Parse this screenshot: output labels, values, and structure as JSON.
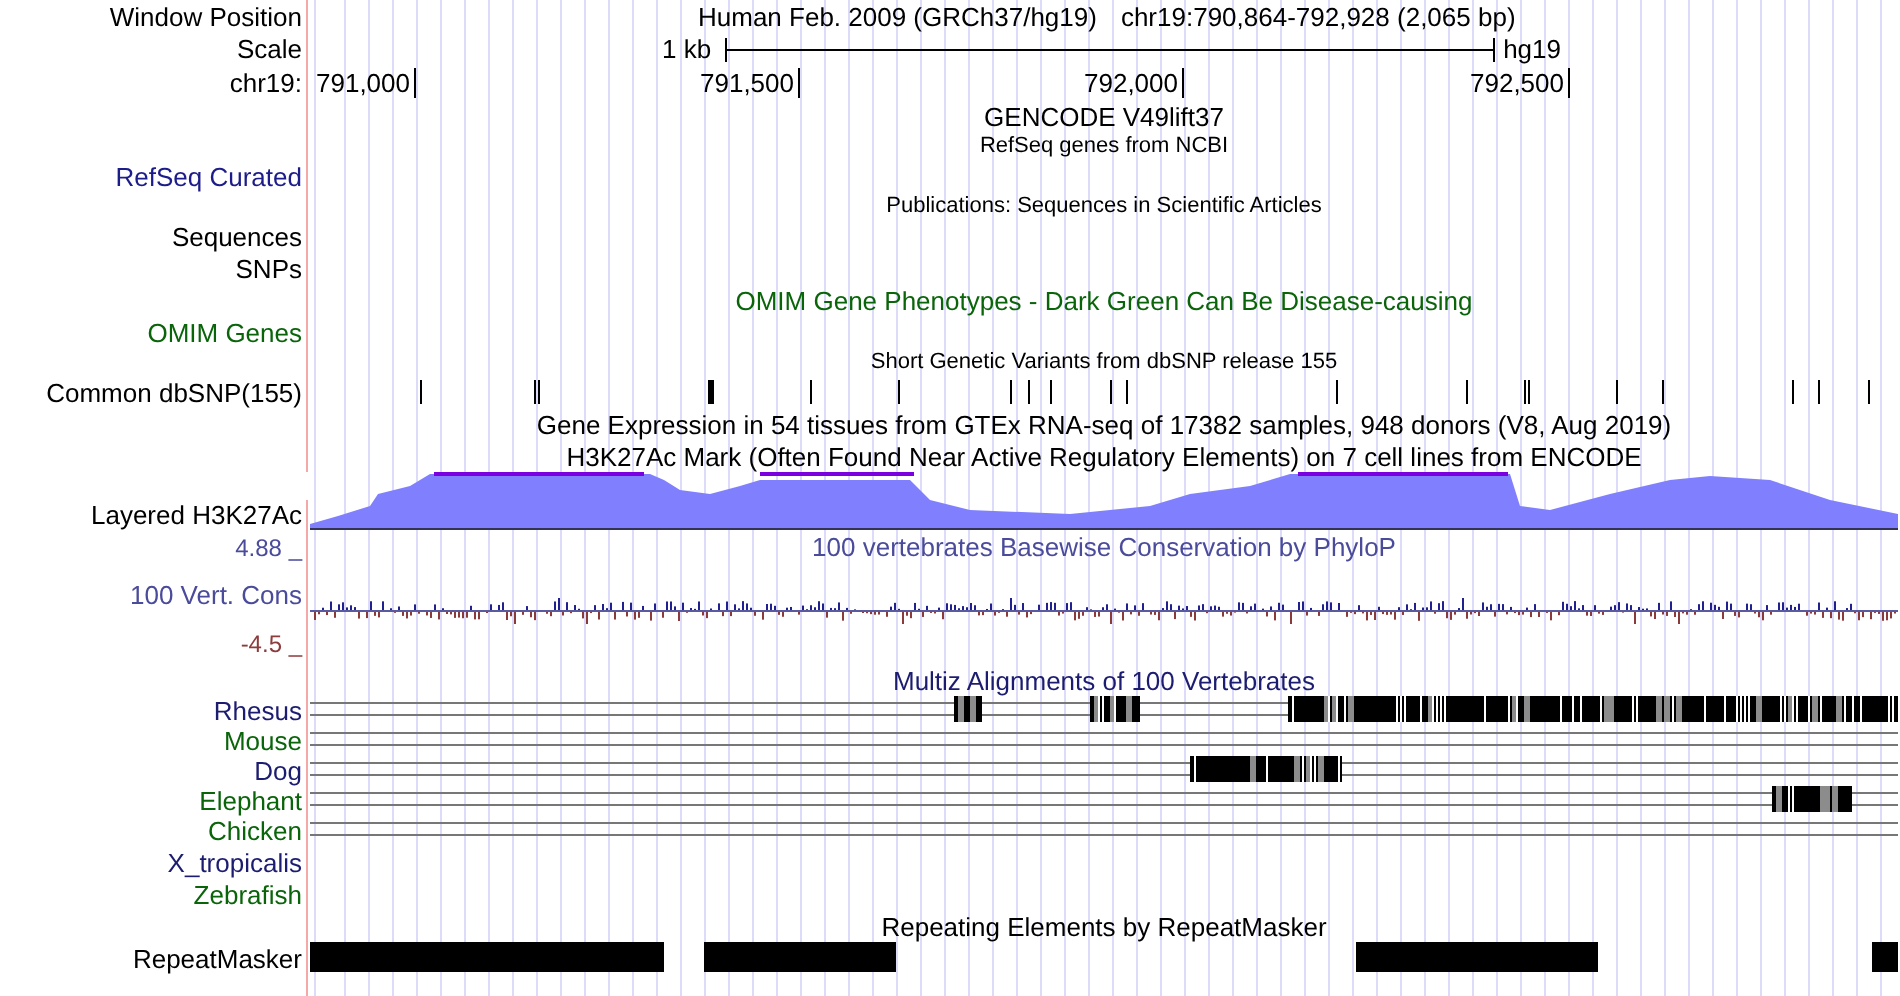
{
  "header": {
    "label": "Window Position",
    "title": "Human Feb. 2009 (GRCh37/hg19)",
    "position": "chr19:790,864-792,928 (2,065 bp)"
  },
  "scale": {
    "label": "Scale",
    "length": "1 kb",
    "assembly": "hg19"
  },
  "ruler": {
    "label": "chr19:",
    "ticks": [
      "791,000",
      "791,500",
      "792,000",
      "792,500"
    ]
  },
  "rows": [
    {
      "kind": "heading",
      "text": "GENCODE V49lift37",
      "color": "#000000"
    },
    {
      "kind": "caption",
      "text": "RefSeq genes from NCBI"
    },
    {
      "kind": "label",
      "label": "RefSeq Curated",
      "color": "#1c1c8a"
    },
    {
      "kind": "caption",
      "text": "Publications: Sequences in Scientific Articles"
    },
    {
      "kind": "label",
      "label": "Sequences",
      "color": "#000000"
    },
    {
      "kind": "label",
      "label": "SNPs",
      "color": "#000000"
    },
    {
      "kind": "heading",
      "text": "OMIM Gene Phenotypes - Dark Green Can Be Disease-causing",
      "color": "#0a640a"
    },
    {
      "kind": "label",
      "label": "OMIM Genes",
      "color": "#0a640a"
    },
    {
      "kind": "caption",
      "text": "Short Genetic Variants from dbSNP release 155"
    },
    {
      "kind": "snps",
      "label": "Common dbSNP(155)",
      "color": "#000000"
    },
    {
      "kind": "heading",
      "text": "Gene Expression in 54 tissues from GTEx RNA-seq of 17382 samples, 948 donors (V8, Aug 2019)",
      "color": "#000000"
    },
    {
      "kind": "heading",
      "text": "H3K27Ac Mark (Often Found Near Active Regulatory Elements) on 7 cell lines from ENCODE",
      "color": "#000000"
    },
    {
      "kind": "density",
      "label": "Layered H3K27Ac",
      "color": "#000000"
    },
    {
      "kind": "scale_top",
      "label": "4.88 _",
      "text": "100 vertebrates Basewise Conservation by PhyloP",
      "color": "#4b4b9b"
    },
    {
      "kind": "wiggle",
      "label": "100 Vert. Cons",
      "color": "#4b4b9b"
    },
    {
      "kind": "scale_bottom",
      "label": "-4.5 _",
      "color": "#8c3c3c"
    },
    {
      "kind": "heading",
      "text": "Multiz Alignments of 100 Vertebrates",
      "color": "#1c1c70"
    },
    {
      "kind": "alignment",
      "label": "Rhesus",
      "color": "#1c1c70"
    },
    {
      "kind": "alignment",
      "label": "Mouse",
      "color": "#0a640a"
    },
    {
      "kind": "alignment",
      "label": "Dog",
      "color": "#1c1c70"
    },
    {
      "kind": "alignment",
      "label": "Elephant",
      "color": "#0a640a"
    },
    {
      "kind": "alignment",
      "label": "Chicken",
      "color": "#0a640a"
    },
    {
      "kind": "label",
      "label": "X_tropicalis",
      "color": "#1c1c70"
    },
    {
      "kind": "label",
      "label": "Zebrafish",
      "color": "#0a640a"
    },
    {
      "kind": "heading",
      "text": "Repeating Elements by RepeatMasker",
      "color": "#000000"
    },
    {
      "kind": "repeats",
      "label": "RepeatMasker",
      "color": "#000000"
    }
  ]
}
